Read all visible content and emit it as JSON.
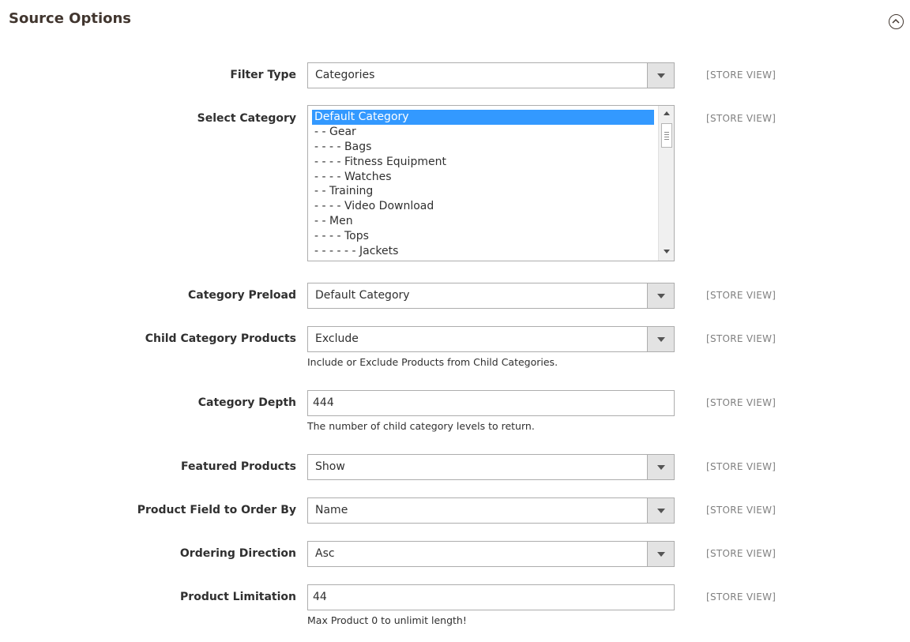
{
  "section": {
    "title": "Source Options"
  },
  "fields": {
    "filter_type": {
      "label": "Filter Type",
      "value": "Categories",
      "scope": "[STORE VIEW]"
    },
    "select_category": {
      "label": "Select Category",
      "scope": "[STORE VIEW]",
      "options": [
        "Default Category",
        "- - Gear",
        "- - - - Bags",
        "- - - - Fitness Equipment",
        "- - - - Watches",
        "- - Training",
        "- - - - Video Download",
        "- - Men",
        "- - - - Tops",
        "- - - - - - Jackets"
      ],
      "selected": "Default Category"
    },
    "category_preload": {
      "label": "Category Preload",
      "value": "Default Category",
      "scope": "[STORE VIEW]"
    },
    "child_category_products": {
      "label": "Child Category Products",
      "value": "Exclude",
      "scope": "[STORE VIEW]",
      "note": "Include or Exclude Products from Child Categories."
    },
    "category_depth": {
      "label": "Category Depth",
      "value": "444",
      "scope": "[STORE VIEW]",
      "note": "The number of child category levels to return."
    },
    "featured_products": {
      "label": "Featured Products",
      "value": "Show",
      "scope": "[STORE VIEW]"
    },
    "product_field_order": {
      "label": "Product Field to Order By",
      "value": "Name",
      "scope": "[STORE VIEW]"
    },
    "ordering_direction": {
      "label": "Ordering Direction",
      "value": "Asc",
      "scope": "[STORE VIEW]"
    },
    "product_limitation": {
      "label": "Product Limitation",
      "value": "44",
      "scope": "[STORE VIEW]",
      "note": "Max Product 0 to unlimit length!"
    }
  }
}
